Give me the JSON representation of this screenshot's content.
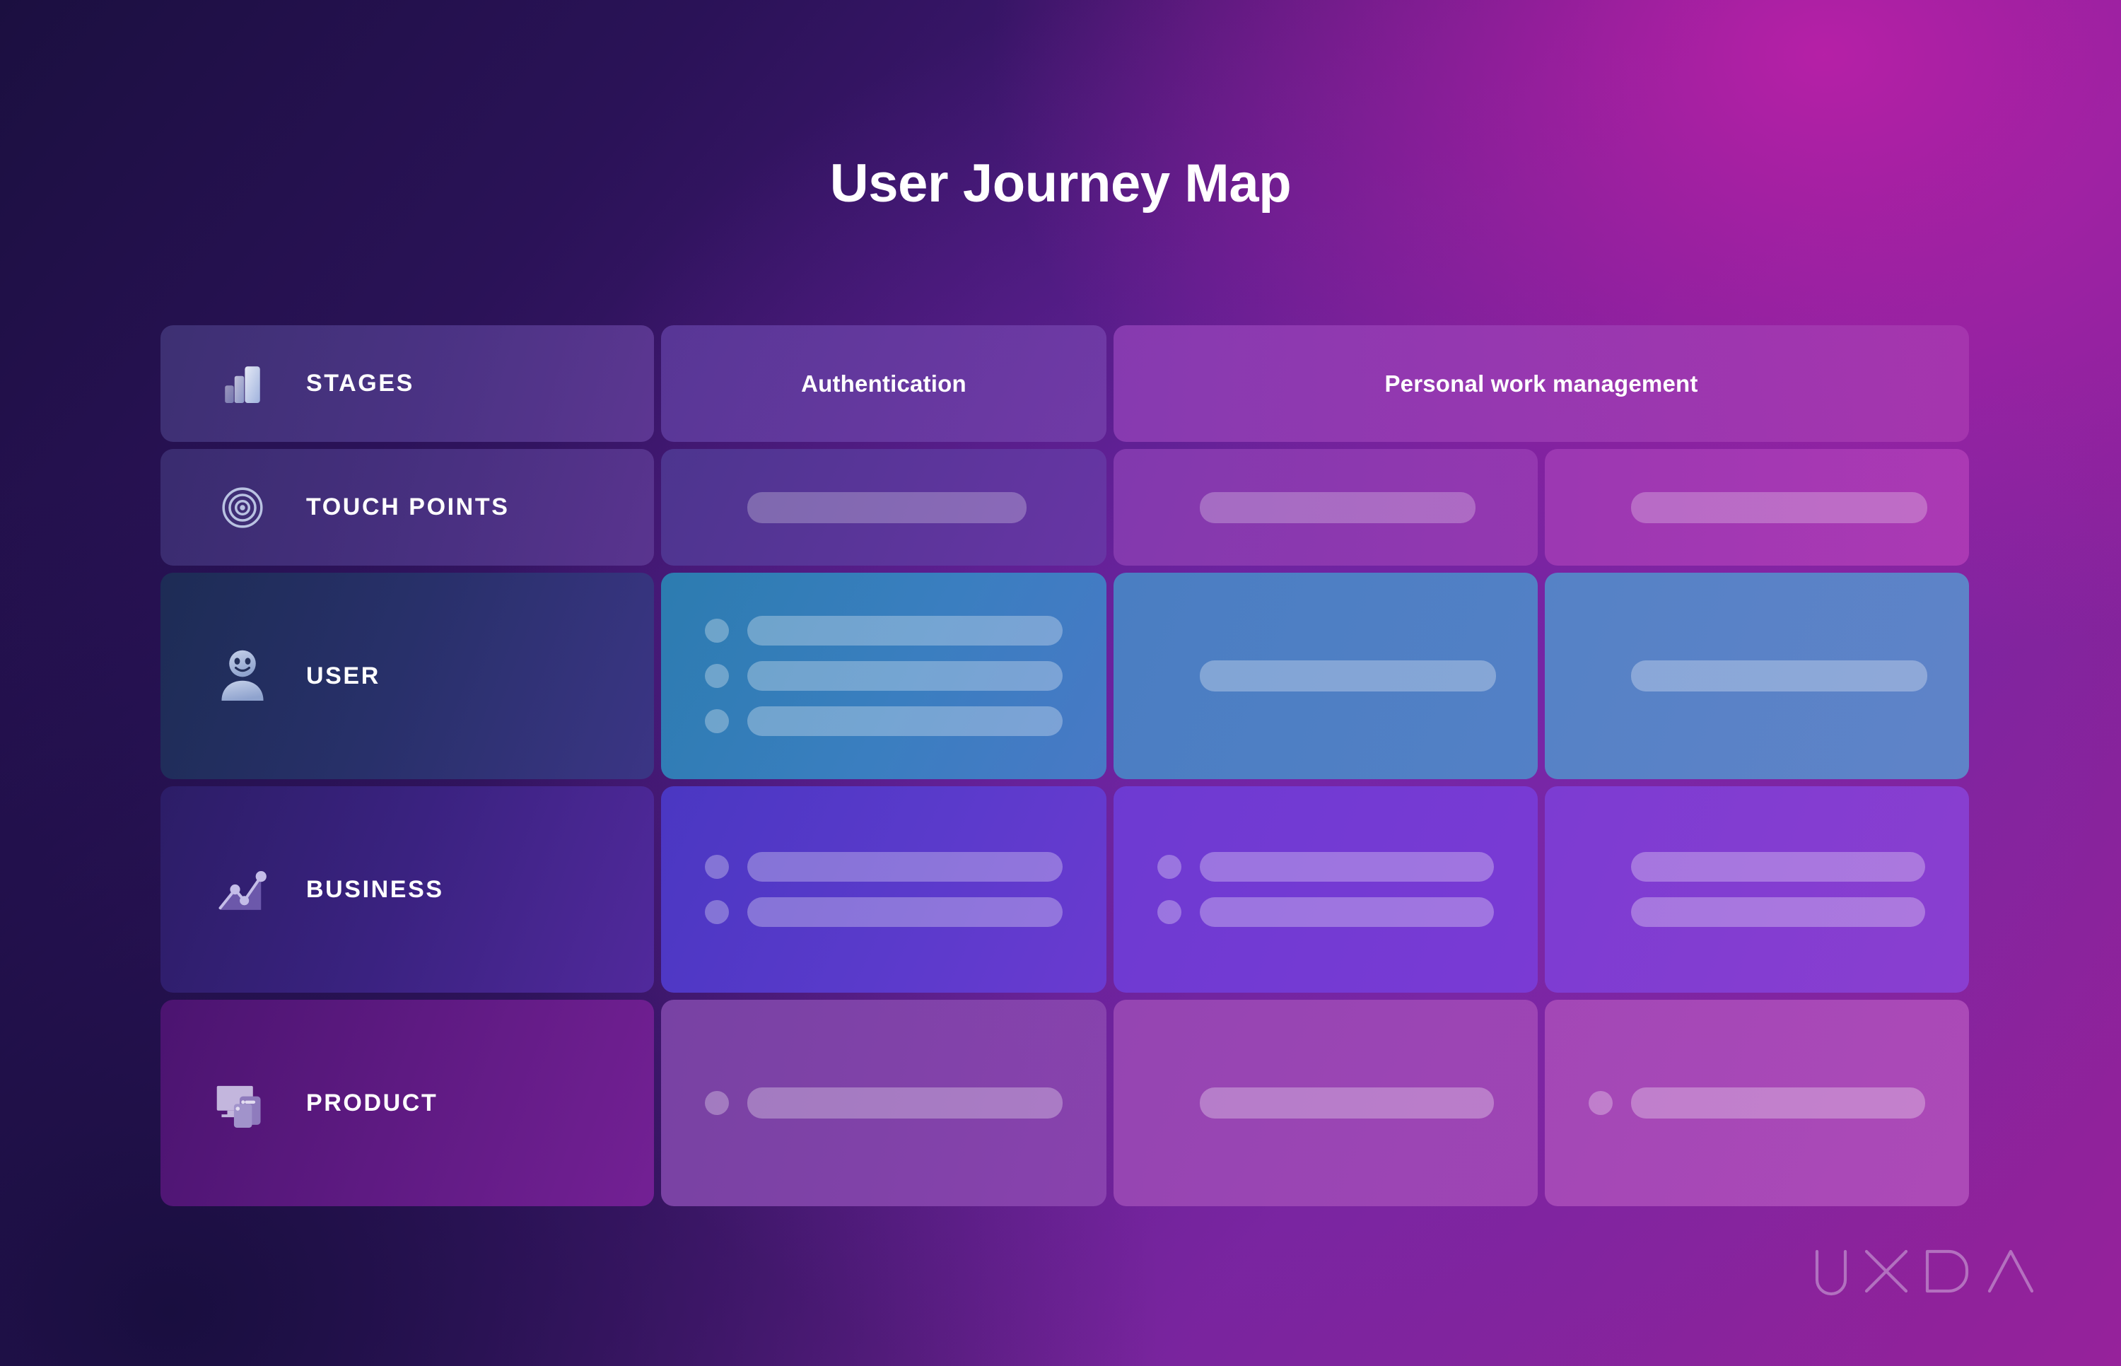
{
  "page": {
    "title": "User Journey Map",
    "brand_logo": "UXDA",
    "accent_magenta": "#96229b",
    "accent_indigo": "#1b0f40",
    "accent_blue": "#3a7ec0",
    "accent_violet": "#6a3ad0"
  },
  "rows": [
    {
      "key": "stages",
      "label": "STAGES",
      "icon": "bar-chart-icon"
    },
    {
      "key": "touchpoints",
      "label": "TOUCH POINTS",
      "icon": "target-icon"
    },
    {
      "key": "user",
      "label": "USER",
      "icon": "user-avatar-icon"
    },
    {
      "key": "business",
      "label": "BUSINESS",
      "icon": "line-chart-icon"
    },
    {
      "key": "product",
      "label": "PRODUCT",
      "icon": "devices-icon"
    }
  ],
  "stages": [
    {
      "label": "Authentication",
      "span": 1
    },
    {
      "label": "Personal work management",
      "span": 2
    }
  ],
  "cells": {
    "touchpoints": [
      {
        "items": [
          {
            "dot": false,
            "bar_width": "78%"
          }
        ]
      },
      {
        "items": [
          {
            "dot": false,
            "bar_width": "82%"
          }
        ]
      },
      {
        "items": [
          {
            "dot": false,
            "bar_width": "88%"
          }
        ]
      }
    ],
    "user": [
      {
        "items": [
          {
            "dot": true,
            "bar_width": "100%"
          },
          {
            "dot": true,
            "bar_width": "100%"
          },
          {
            "dot": true,
            "bar_width": "100%"
          }
        ]
      },
      {
        "items": [
          {
            "dot": false,
            "bar_width": "88%"
          }
        ]
      },
      {
        "items": [
          {
            "dot": false,
            "bar_width": "88%"
          }
        ]
      }
    ],
    "business": [
      {
        "items": [
          {
            "dot": true,
            "bar_width": "100%"
          },
          {
            "dot": true,
            "bar_width": "100%"
          }
        ]
      },
      {
        "items": [
          {
            "dot": true,
            "bar_width": "100%"
          },
          {
            "dot": true,
            "bar_width": "100%"
          }
        ]
      },
      {
        "items": [
          {
            "dot": false,
            "bar_width": "100%"
          },
          {
            "dot": false,
            "bar_width": "100%"
          }
        ]
      }
    ],
    "product": [
      {
        "items": [
          {
            "dot": true,
            "bar_width": "100%"
          }
        ]
      },
      {
        "items": [
          {
            "dot": false,
            "bar_width": "100%"
          }
        ]
      },
      {
        "items": [
          {
            "dot": true,
            "bar_width": "100%"
          }
        ]
      }
    ]
  }
}
